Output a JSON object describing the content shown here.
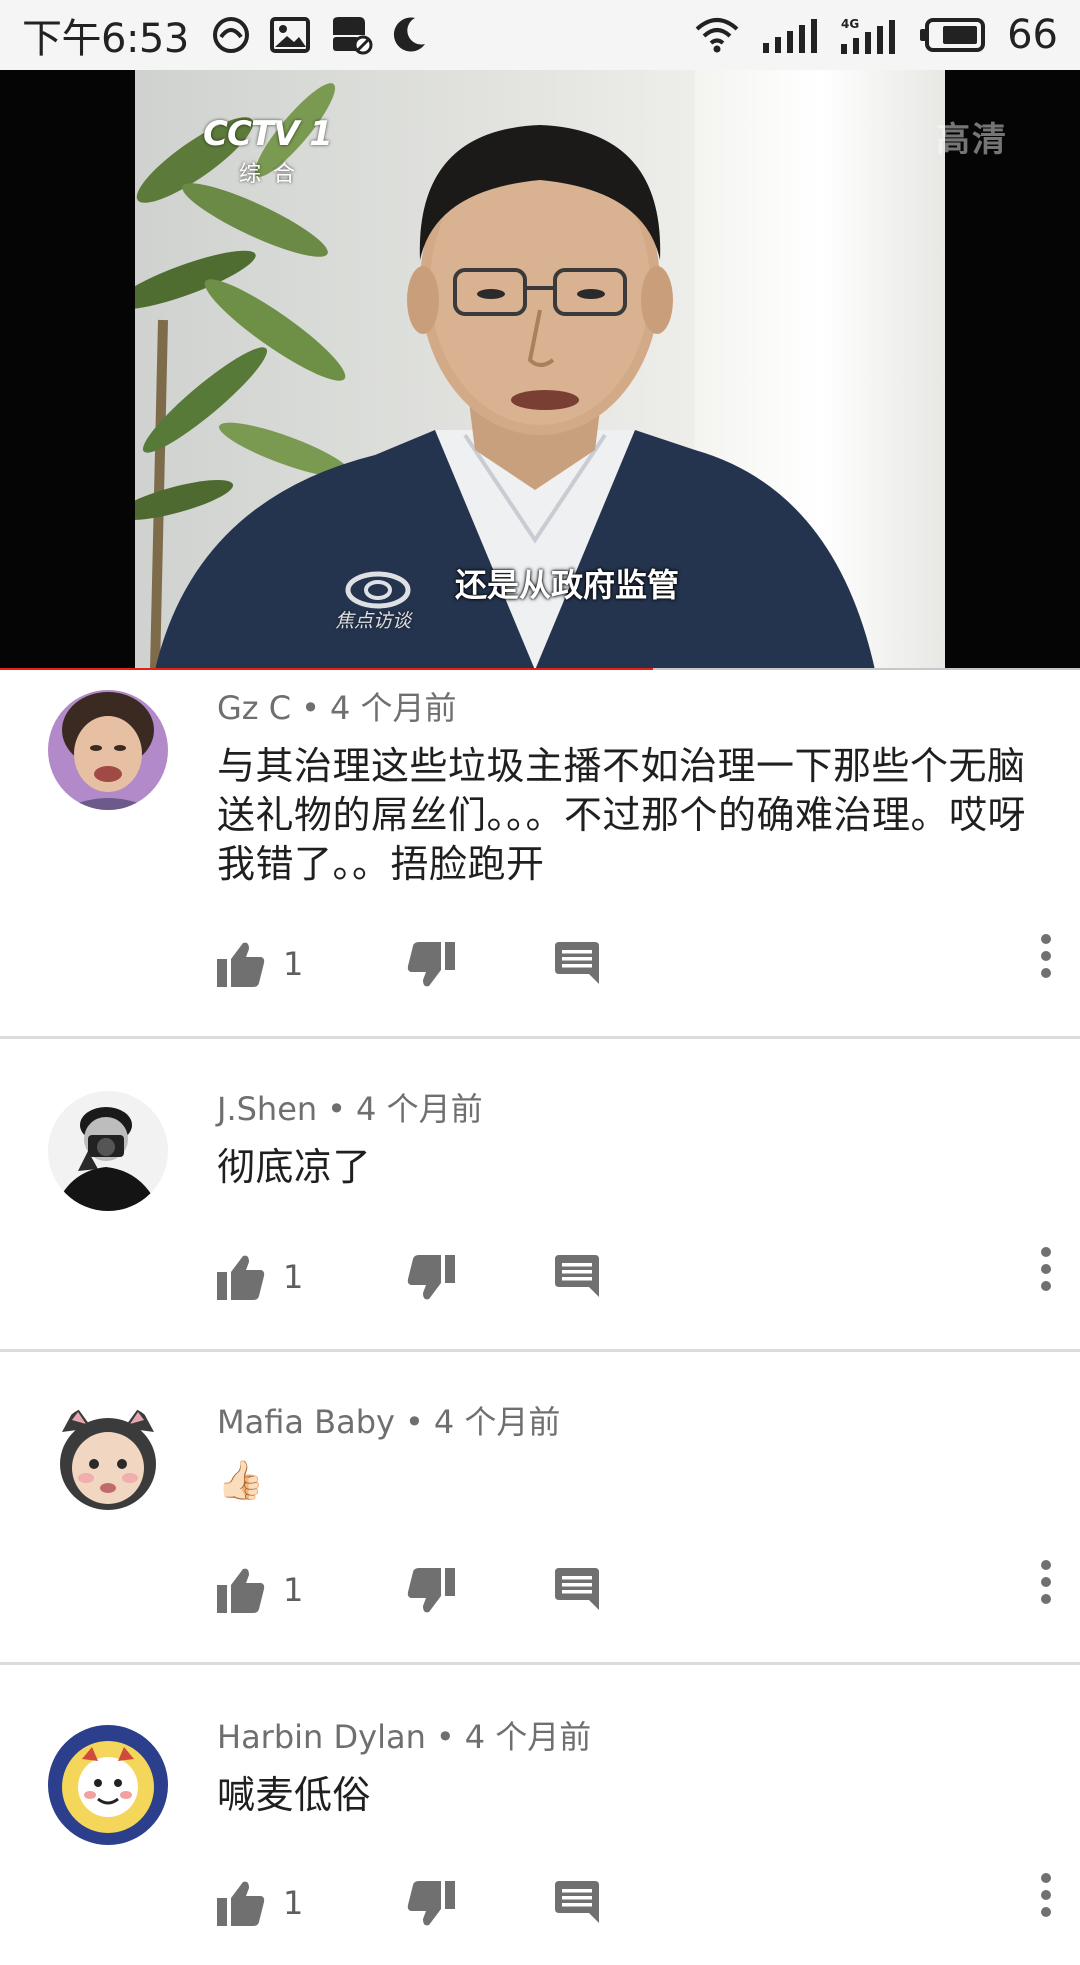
{
  "status_bar": {
    "time": "下午6:53",
    "network_label": "4G",
    "battery_level": "66",
    "icons": [
      "sync-icon",
      "gallery-icon",
      "notification-icon",
      "moon-icon",
      "wifi-icon",
      "signal-icon",
      "signal-4g-icon",
      "battery-icon"
    ]
  },
  "video": {
    "channel_logo": "CCTV 1",
    "channel_sub": "综合",
    "hd_mark": "高清",
    "program_logo": "焦点访谈",
    "subtitle": "还是从政府监管",
    "progress_fraction": 0.605,
    "progress_color": "#e62117"
  },
  "comments": [
    {
      "author": "Gz C",
      "time": "4 个月前",
      "text": "与其治理这些垃圾主播不如治理一下那些个无脑送礼物的屌丝们。。。不过那个的确难治理。哎呀我错了。。捂脸跑开",
      "likes": "1",
      "avatar": "avatar-woman-icon"
    },
    {
      "author": "J.Shen",
      "time": "4 个月前",
      "text": "彻底凉了",
      "likes": "1",
      "avatar": "avatar-photographer-icon"
    },
    {
      "author": "Mafia Baby",
      "time": "4 个月前",
      "text": "👍🏻",
      "likes": "1",
      "avatar": "avatar-baby-cat-icon"
    },
    {
      "author": "Harbin Dylan",
      "time": "4 个月前",
      "text": "喊麦低俗",
      "likes": "1",
      "avatar": "avatar-cartoon-icon"
    }
  ],
  "colors": {
    "icon_gray": "#707070",
    "divider": "#dcdcdc",
    "text": "#1f1f1f",
    "meta": "#6f6f6f"
  }
}
